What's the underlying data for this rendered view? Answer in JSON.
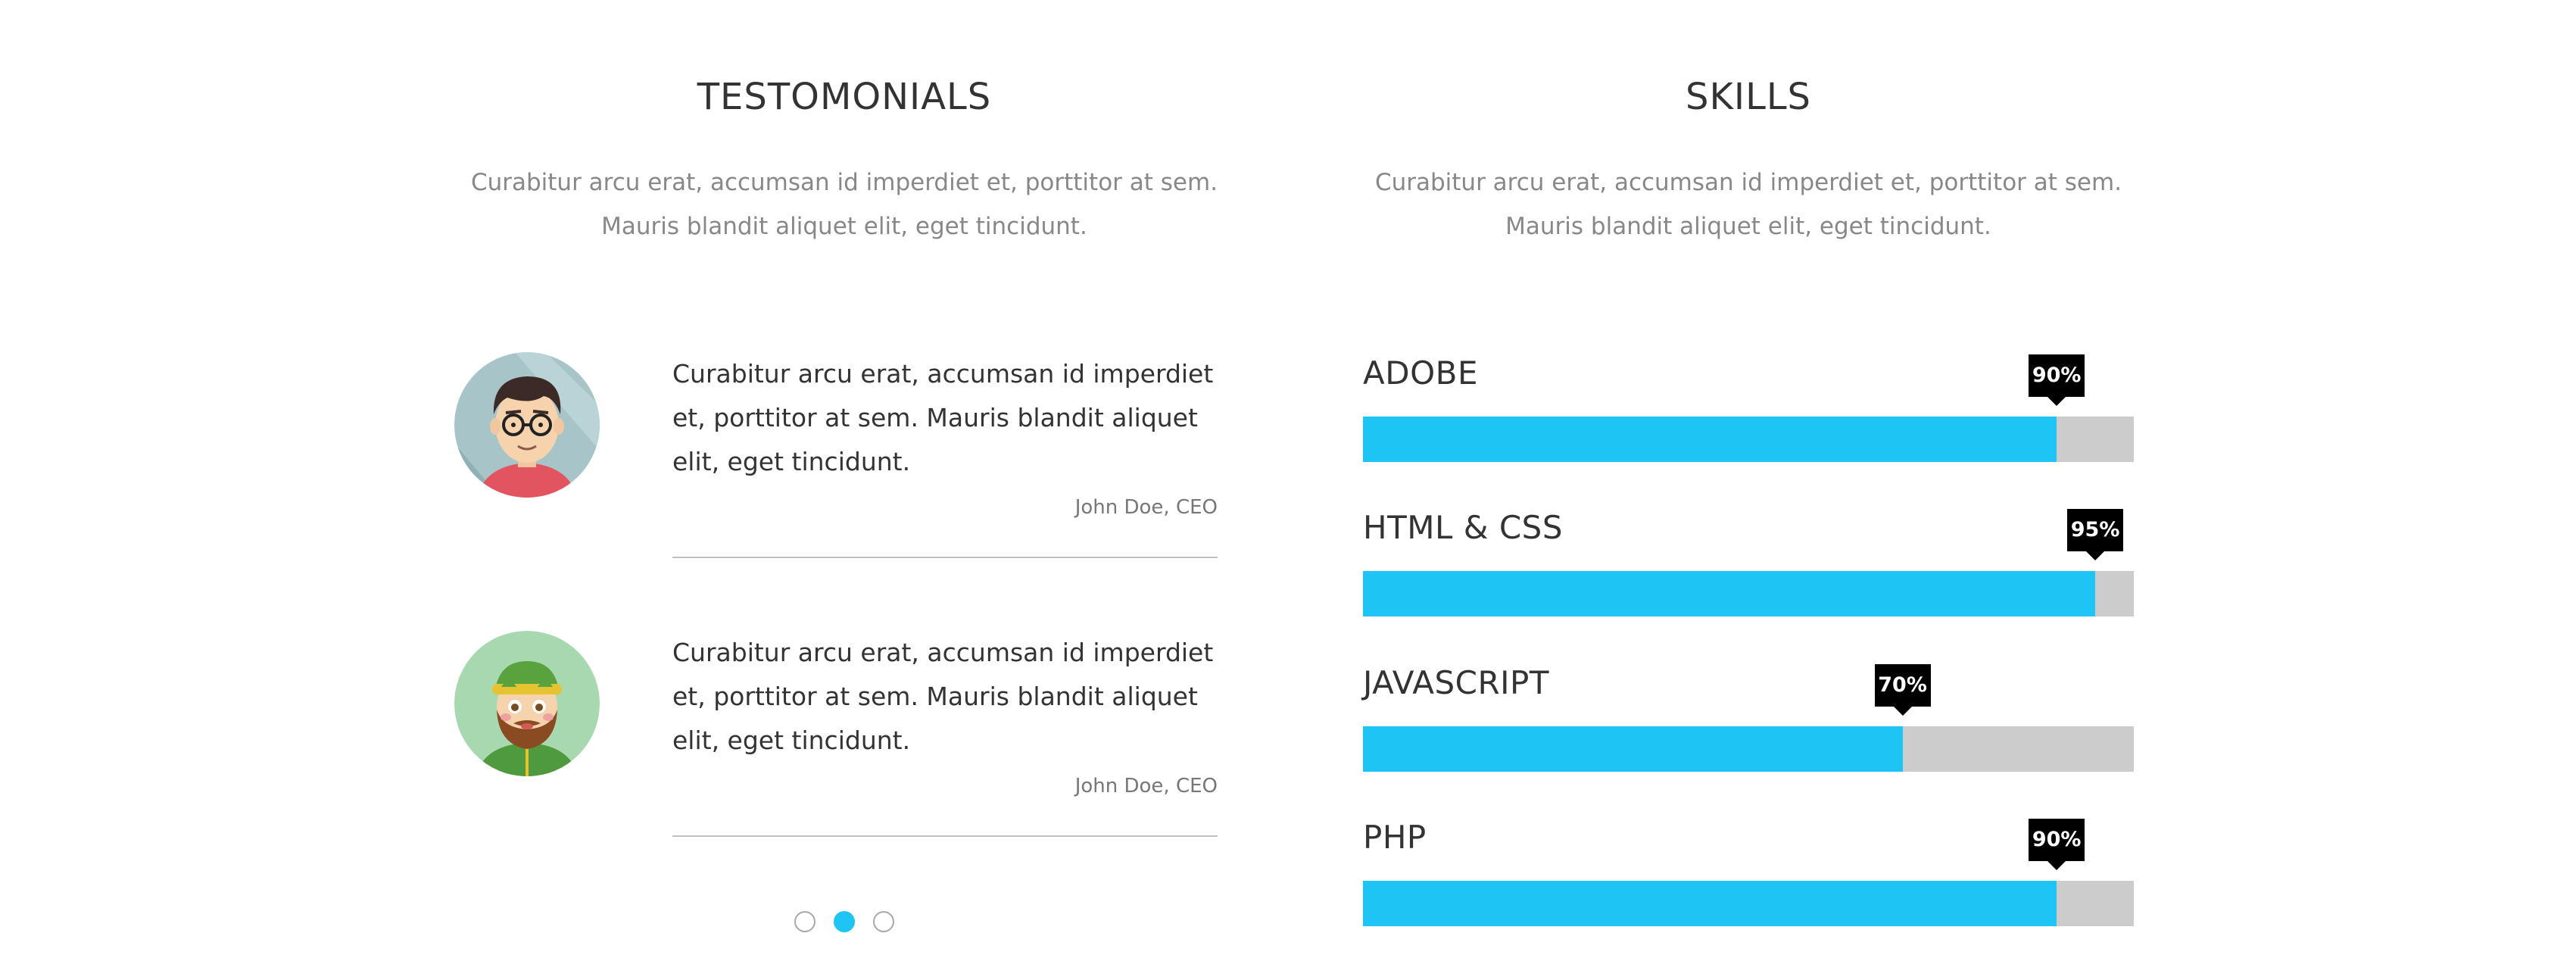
{
  "testimonials": {
    "title": "TESTOMONIALS",
    "description": [
      "Curabitur arcu erat, accumsan id imperdiet et, porttitor at sem.",
      "Mauris blandit aliquet elit, eget tincidunt."
    ],
    "items": [
      {
        "avatar_icon": "man-with-glasses-avatar-icon",
        "quote": "Curabitur arcu erat, accumsan id imperdiet et, porttitor at sem. Mauris blandit aliquet elit, eget tincidunt.",
        "author": "John Doe, CEO"
      },
      {
        "avatar_icon": "bearded-man-with-hat-avatar-icon",
        "quote": "Curabitur arcu erat, accumsan id imperdiet et, porttitor at sem. Mauris blandit aliquet elit, eget tincidunt.",
        "author": "John Doe, CEO"
      }
    ],
    "pagination": {
      "count": 3,
      "active_index": 1
    }
  },
  "skills": {
    "title": "SKILLS",
    "description": [
      "Curabitur arcu erat, accumsan id imperdiet et, porttitor at sem.",
      "Mauris blandit aliquet elit, eget tincidunt."
    ],
    "items": [
      {
        "label": "ADOBE",
        "percent": 90,
        "percent_label": "90%"
      },
      {
        "label": "HTML & CSS",
        "percent": 95,
        "percent_label": "95%"
      },
      {
        "label": "JAVASCRIPT",
        "percent": 70,
        "percent_label": "70%"
      },
      {
        "label": "PHP",
        "percent": 90,
        "percent_label": "90%"
      }
    ]
  },
  "colors": {
    "accent": "#1ec5f4",
    "bar_track": "#cccccc",
    "tag_background": "#000000",
    "heading_text": "#333333",
    "muted_text": "#888888"
  }
}
